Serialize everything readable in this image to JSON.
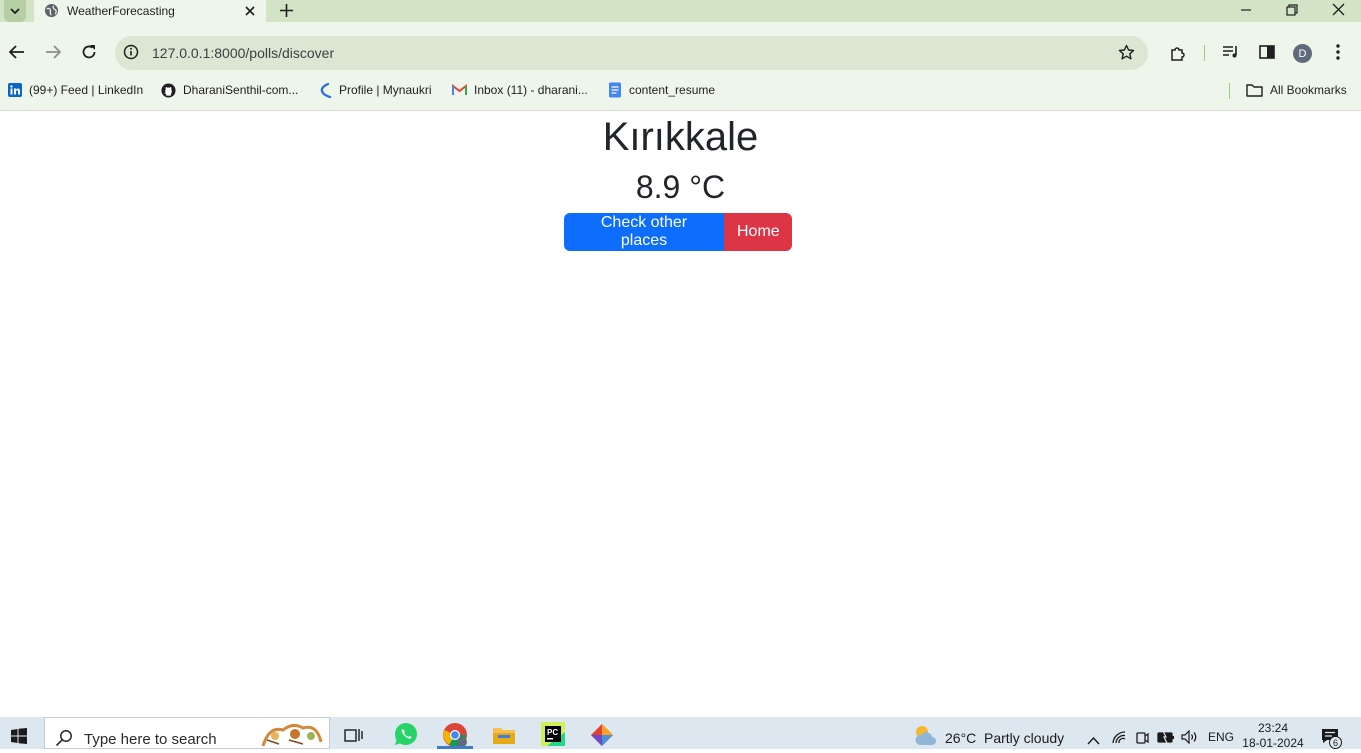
{
  "browser": {
    "tab_title": "WeatherForecasting",
    "url": "127.0.0.1:8000/polls/discover",
    "profile_initial": "D"
  },
  "bookmarks": {
    "items": [
      {
        "label": "(99+) Feed | LinkedIn",
        "icon": "linkedin-icon"
      },
      {
        "label": "DharaniSenthil-com...",
        "icon": "github-icon"
      },
      {
        "label": "Profile | Mynaukri",
        "icon": "naukri-icon"
      },
      {
        "label": "Inbox (11) - dharani...",
        "icon": "gmail-icon"
      },
      {
        "label": "content_resume",
        "icon": "docs-icon"
      }
    ],
    "all_bookmarks": "All Bookmarks"
  },
  "page": {
    "city": "Kırıkkale",
    "temperature": "8.9 °C",
    "check_other_label": "Check other places",
    "home_label": "Home"
  },
  "taskbar": {
    "search_placeholder": "Type here to search",
    "weather_temp": "26°C",
    "weather_desc": "Partly cloudy",
    "language": "ENG",
    "time": "23:24",
    "date": "18-01-2024",
    "notification_count": "6"
  },
  "colors": {
    "primary": "#0d6efd",
    "danger": "#dc3545",
    "browser_chrome": "#eef5ea"
  }
}
